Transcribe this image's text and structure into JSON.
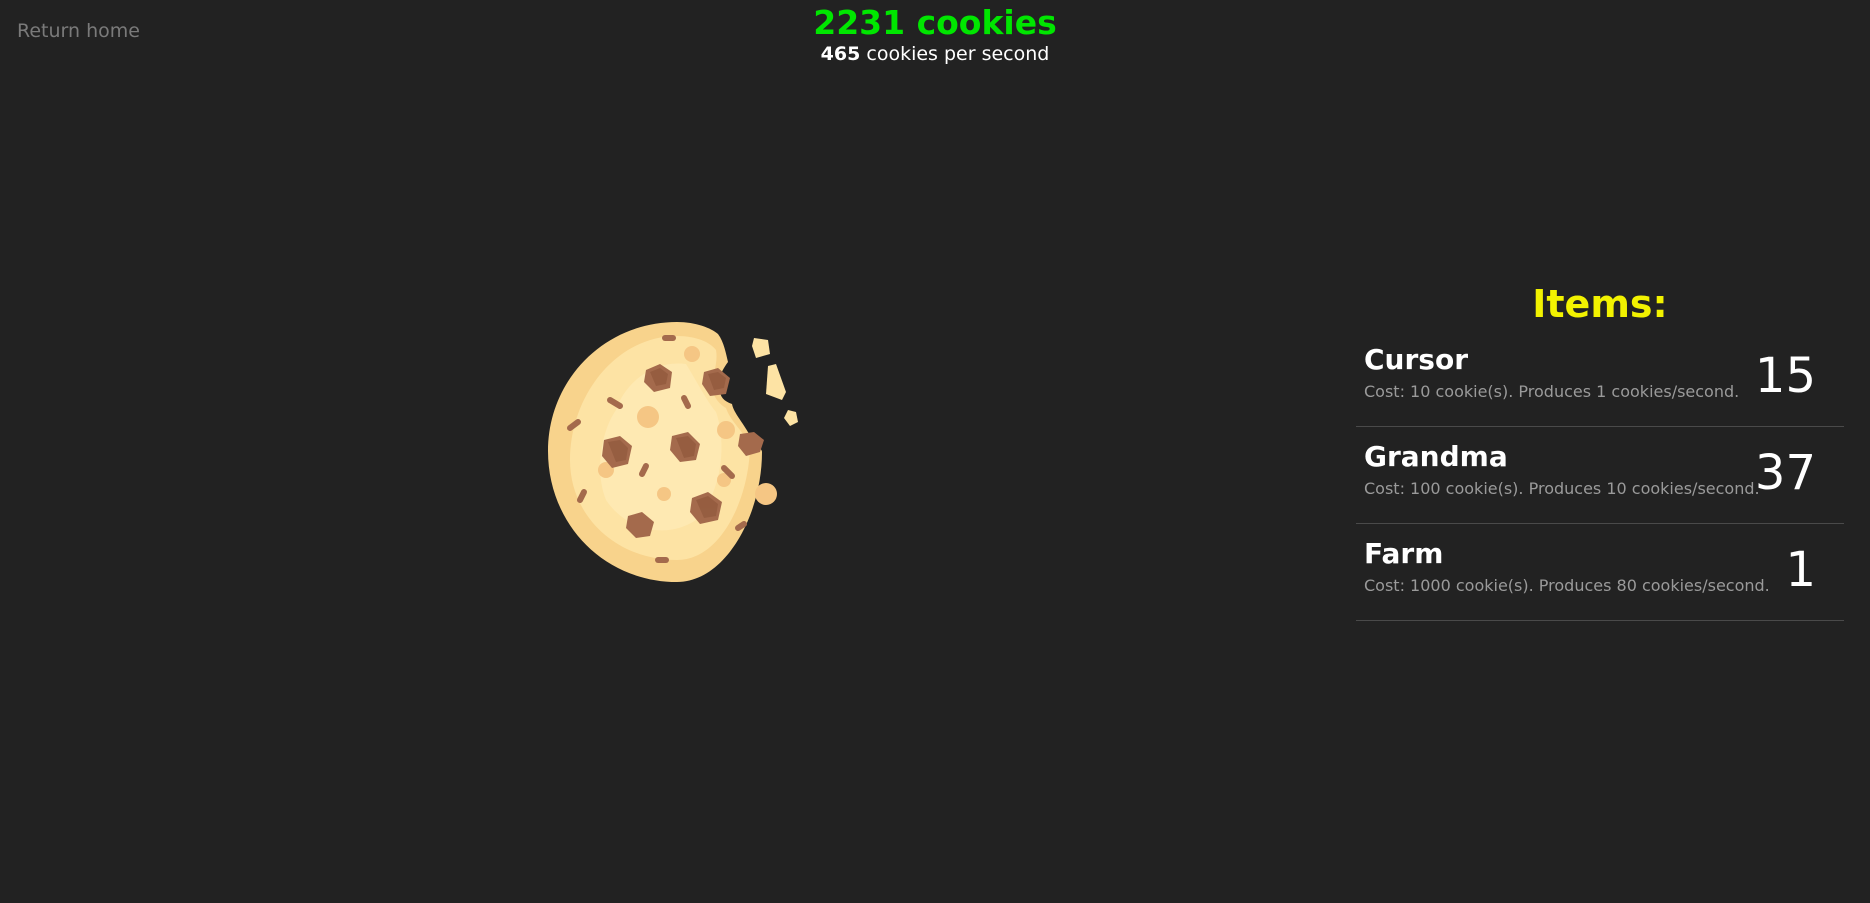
{
  "nav": {
    "return_home": "Return home"
  },
  "header": {
    "cookies": "2231 cookies",
    "cps_value": "465",
    "cps_suffix": " cookies per second"
  },
  "items_panel": {
    "title": "Items:",
    "items": [
      {
        "name": "Cursor",
        "desc": "Cost: 10 cookie(s). Produces 1 cookies/second.",
        "owned": "15"
      },
      {
        "name": "Grandma",
        "desc": "Cost: 100 cookie(s). Produces 10 cookies/second.",
        "owned": "37"
      },
      {
        "name": "Farm",
        "desc": "Cost: 1000 cookie(s). Produces 80 cookies/second.",
        "owned": "1"
      }
    ]
  },
  "colors": {
    "background": "#222222",
    "cookie_count": "#00e600",
    "items_title": "#f2f200"
  },
  "icons": {
    "cookie": "cookie-icon"
  }
}
